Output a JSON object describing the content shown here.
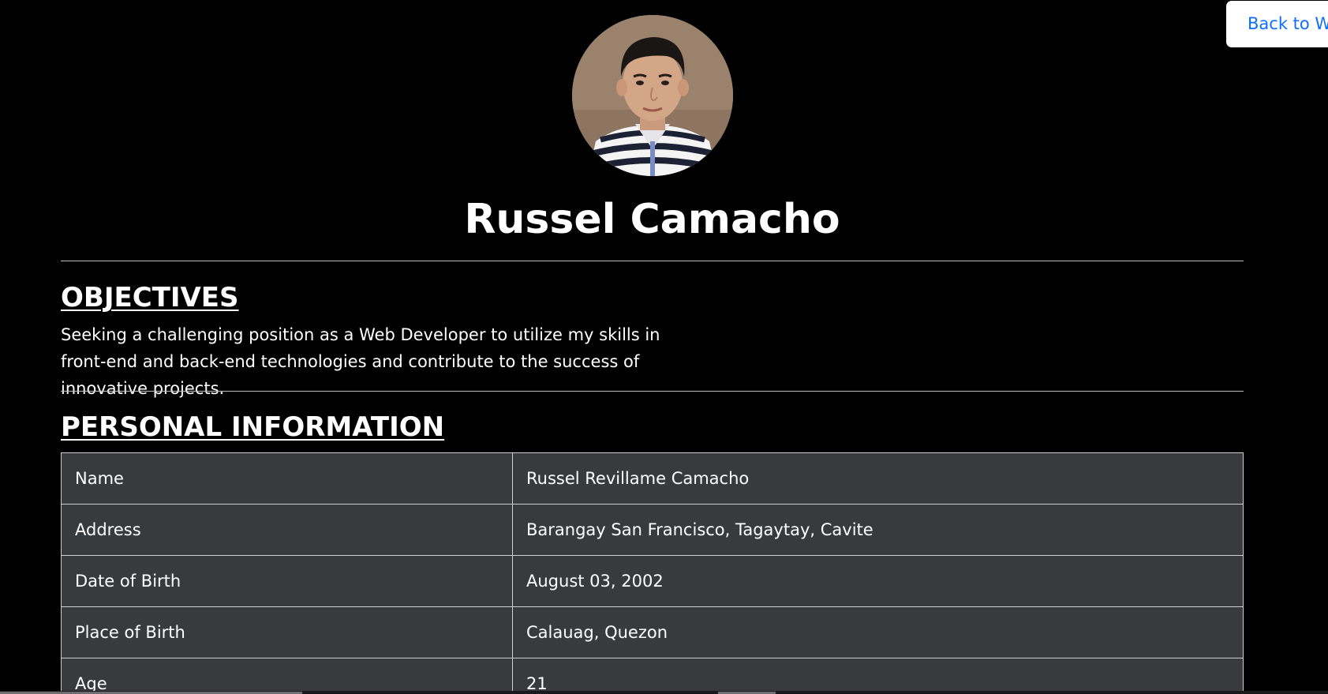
{
  "nav": {
    "back_label": "Back to Website"
  },
  "profile": {
    "name": "Russel Camacho",
    "photo_icon": "profile-photo"
  },
  "objectives": {
    "heading": "OBJECTIVES",
    "text": "Seeking a challenging position as a Web Developer to utilize my skills in front-end and back-end technologies and contribute to the success of innovative projects."
  },
  "personal_info": {
    "heading": "PERSONAL INFORMATION",
    "rows": [
      {
        "label": "Name",
        "value": "Russel Revillame Camacho"
      },
      {
        "label": "Address",
        "value": "Barangay San Francisco, Tagaytay, Cavite"
      },
      {
        "label": "Date of Birth",
        "value": "August 03, 2002"
      },
      {
        "label": "Place of Birth",
        "value": "Calauag, Quezon"
      },
      {
        "label": "Age",
        "value": "21"
      }
    ]
  },
  "colors": {
    "background": "#000000",
    "table_bg": "#373b3e",
    "button_text": "#0d6efd",
    "button_bg": "#ffffff"
  }
}
